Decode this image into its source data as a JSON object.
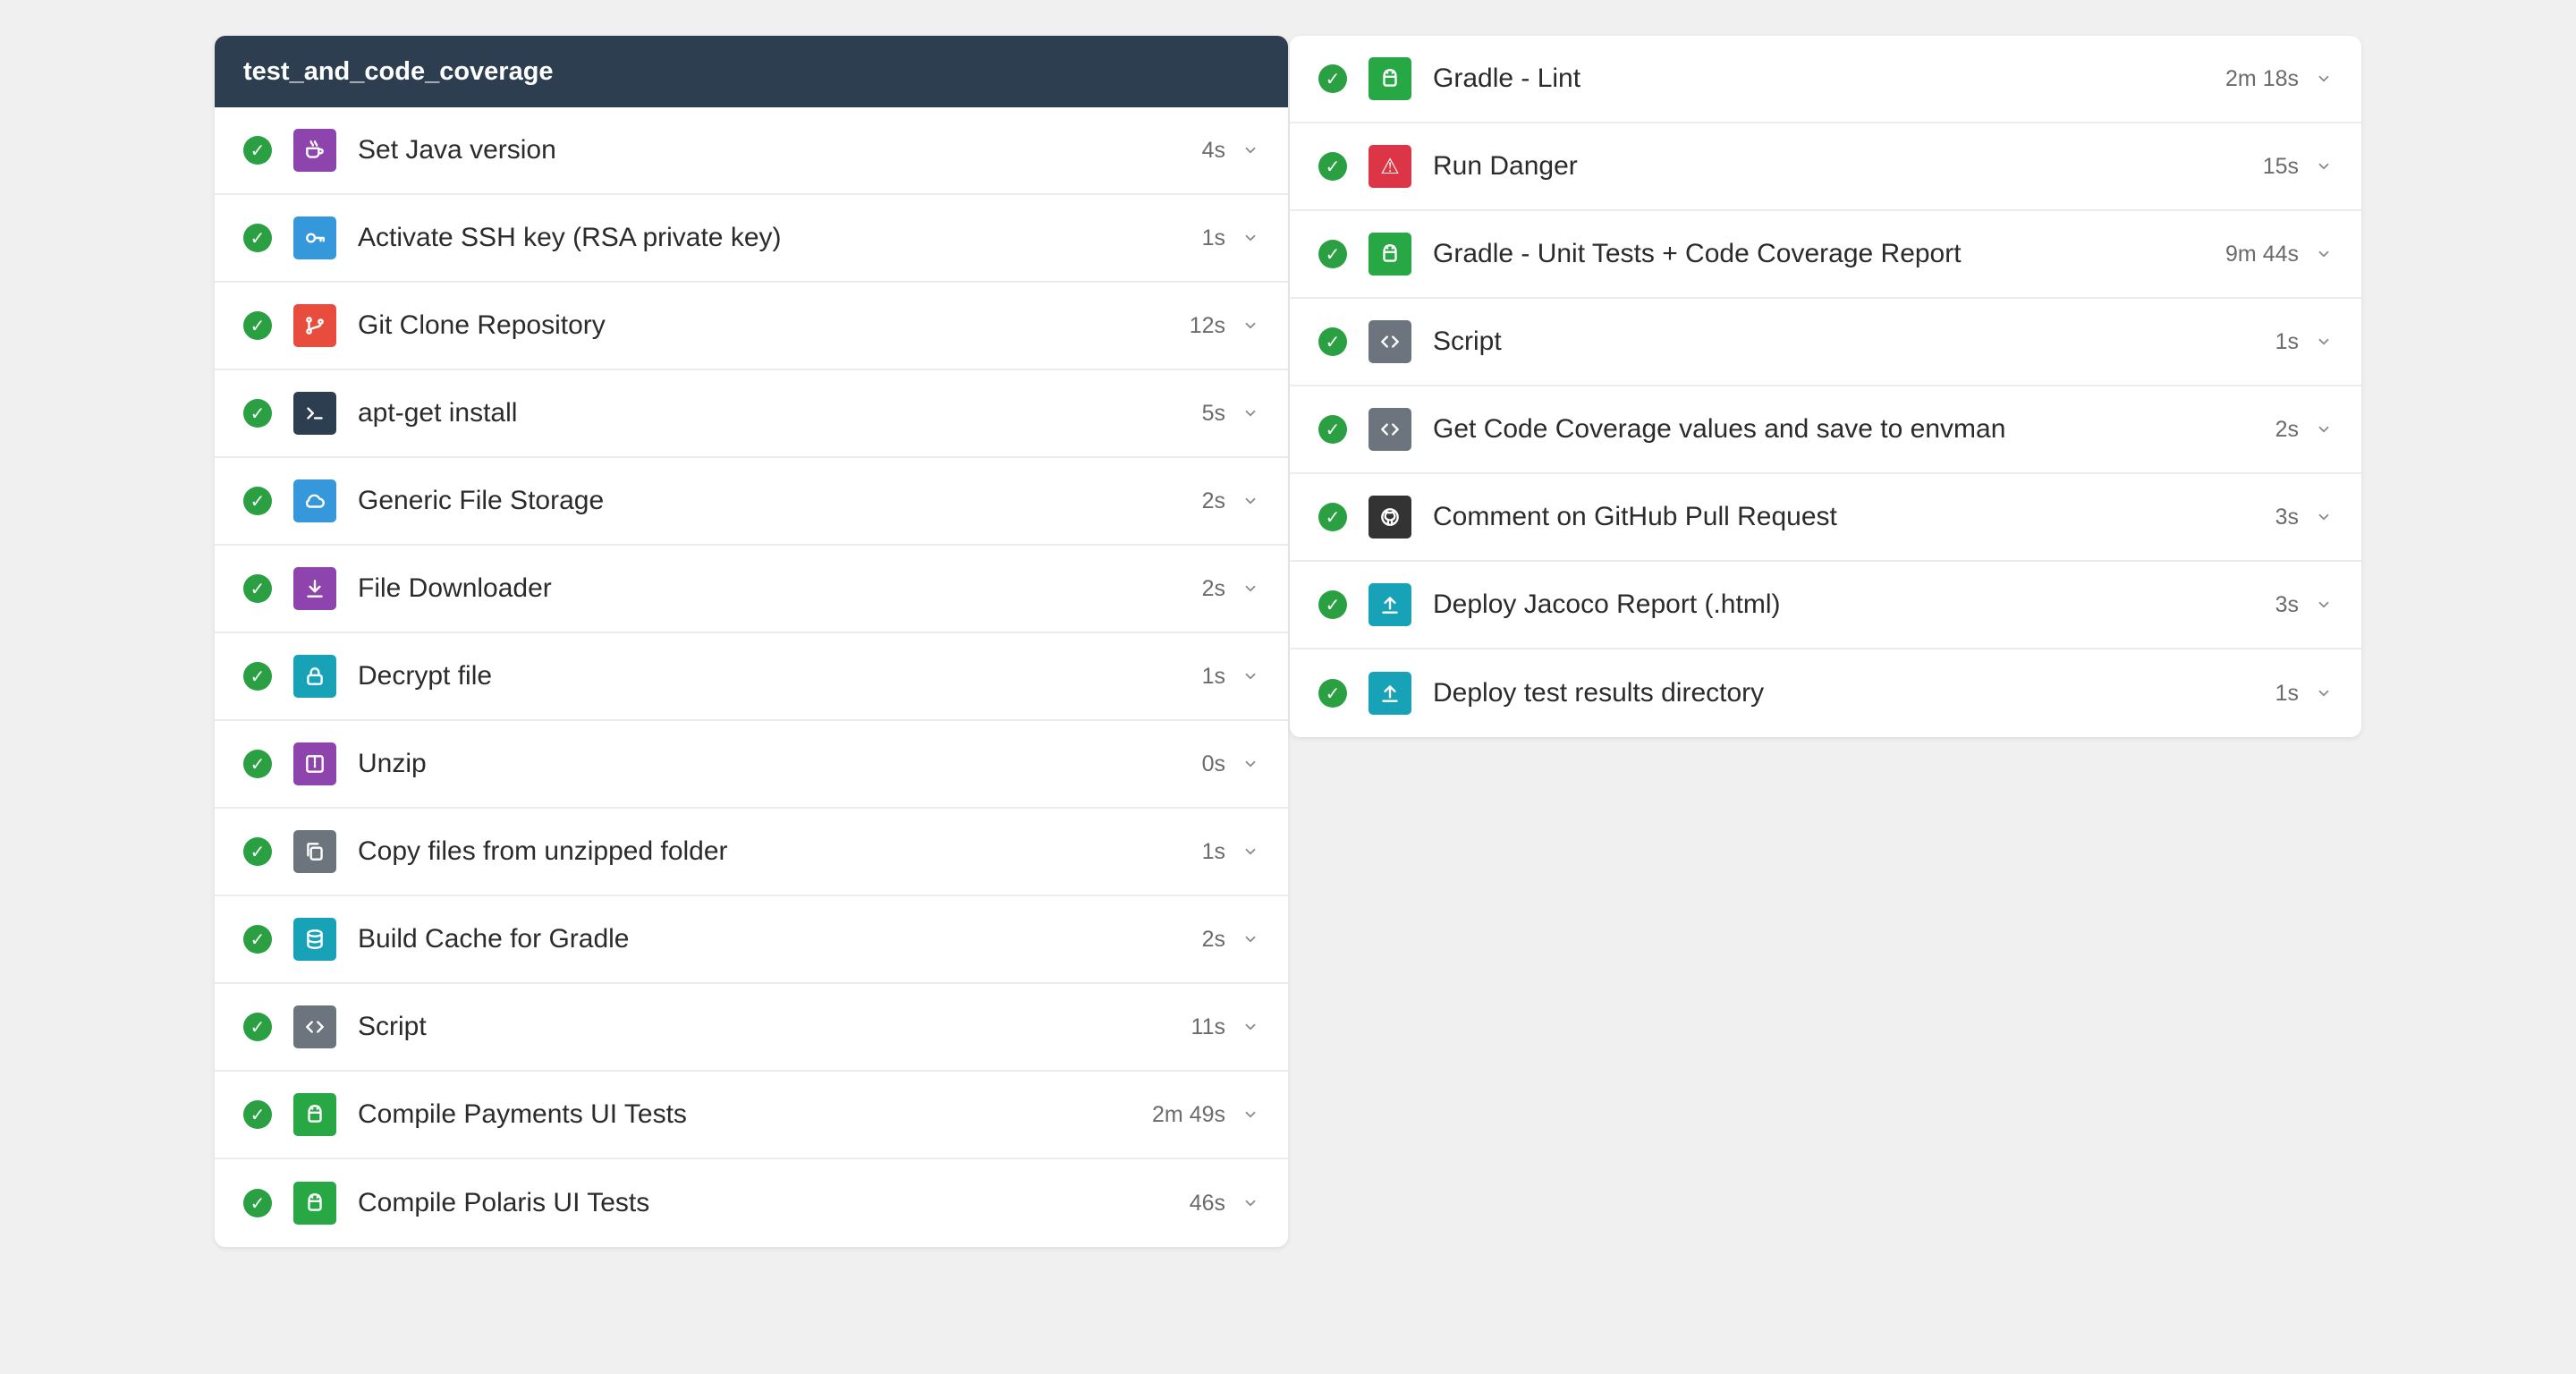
{
  "workflow": {
    "title": "test_and_code_coverage"
  },
  "left_steps": [
    {
      "label": "Set Java version",
      "duration": "4s",
      "status": "success",
      "icon": "coffee-icon",
      "color": "#8e44ad"
    },
    {
      "label": "Activate SSH key (RSA private key)",
      "duration": "1s",
      "status": "success",
      "icon": "key-icon",
      "color": "#3498db"
    },
    {
      "label": "Git Clone Repository",
      "duration": "12s",
      "status": "success",
      "icon": "git-icon",
      "color": "#e74c3c"
    },
    {
      "label": "apt-get install",
      "duration": "5s",
      "status": "success",
      "icon": "terminal-icon",
      "color": "#2c3e50"
    },
    {
      "label": "Generic File Storage",
      "duration": "2s",
      "status": "success",
      "icon": "cloud-icon",
      "color": "#3498db"
    },
    {
      "label": "File Downloader",
      "duration": "2s",
      "status": "success",
      "icon": "download-icon",
      "color": "#8e44ad"
    },
    {
      "label": "Decrypt file",
      "duration": "1s",
      "status": "success",
      "icon": "lock-icon",
      "color": "#17a2b8"
    },
    {
      "label": "Unzip",
      "duration": "0s",
      "status": "success",
      "icon": "archive-icon",
      "color": "#8e44ad"
    },
    {
      "label": "Copy files from unzipped folder",
      "duration": "1s",
      "status": "success",
      "icon": "copy-icon",
      "color": "#6c757d"
    },
    {
      "label": "Build Cache for Gradle",
      "duration": "2s",
      "status": "success",
      "icon": "database-icon",
      "color": "#17a2b8"
    },
    {
      "label": "Script",
      "duration": "11s",
      "status": "success",
      "icon": "code-icon",
      "color": "#6c757d"
    },
    {
      "label": "Compile Payments UI Tests",
      "duration": "2m 49s",
      "status": "success",
      "icon": "android-icon",
      "color": "#28a745"
    },
    {
      "label": "Compile Polaris UI Tests",
      "duration": "46s",
      "status": "success",
      "icon": "android-icon",
      "color": "#28a745"
    }
  ],
  "right_steps": [
    {
      "label": "Gradle - Lint",
      "duration": "2m 18s",
      "status": "success",
      "icon": "android-icon",
      "color": "#28a745"
    },
    {
      "label": "Run Danger",
      "duration": "15s",
      "status": "success",
      "icon": "warning-icon",
      "color": "#dc3545",
      "glyph": "⚠"
    },
    {
      "label": "Gradle - Unit Tests + Code Coverage Report",
      "duration": "9m 44s",
      "status": "success",
      "icon": "android-icon",
      "color": "#28a745"
    },
    {
      "label": "Script",
      "duration": "1s",
      "status": "success",
      "icon": "code-icon",
      "color": "#6c757d"
    },
    {
      "label": "Get Code Coverage values and save to envman",
      "duration": "2s",
      "status": "success",
      "icon": "code-icon",
      "color": "#6c757d"
    },
    {
      "label": "Comment on GitHub Pull Request",
      "duration": "3s",
      "status": "success",
      "icon": "github-icon",
      "color": "#333333"
    },
    {
      "label": "Deploy Jacoco Report (.html)",
      "duration": "3s",
      "status": "success",
      "icon": "upload-icon",
      "color": "#17a2b8"
    },
    {
      "label": "Deploy test results directory",
      "duration": "1s",
      "status": "success",
      "icon": "upload-icon",
      "color": "#17a2b8"
    }
  ],
  "status_glyph": "✓",
  "colors": {
    "header_bg": "#2c3e50",
    "success": "#2aa043",
    "page_bg": "#f0f0f0"
  }
}
